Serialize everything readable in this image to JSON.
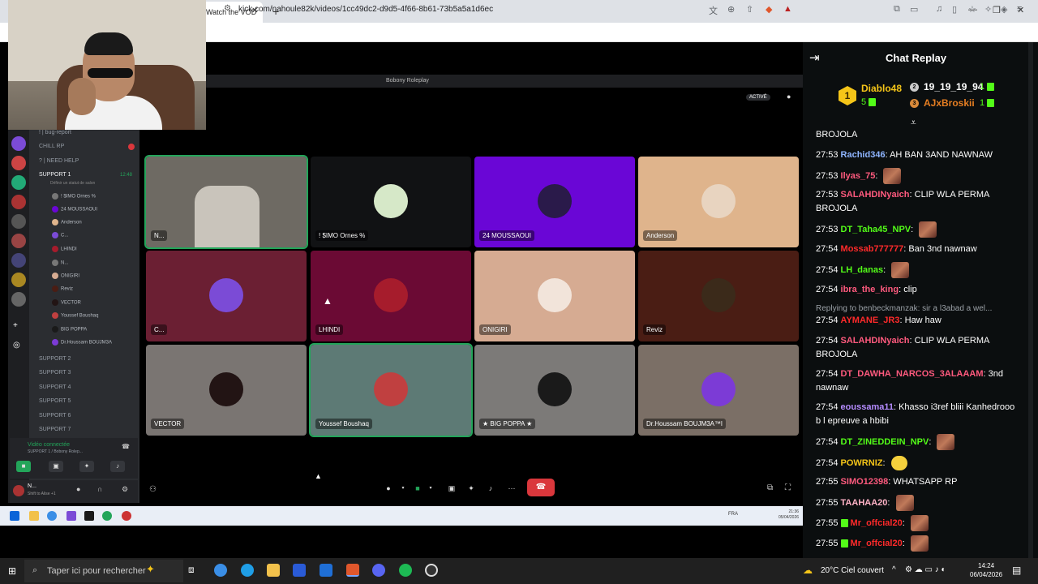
{
  "browser": {
    "tab_title": "Watch the VOD",
    "url": "kick.com/nahoule82k/videos/1cc49dc2-d9d5-4f66-8b61-73b5a5a1d6ec"
  },
  "discord": {
    "window_title": "Bobony Roleplay",
    "active_label": "ACTIVÉ",
    "channels": [
      {
        "label": "! | bug-report",
        "active": false
      },
      {
        "label": "CHILL RP",
        "active": false
      },
      {
        "label": "? | NEED HELP",
        "active": false
      },
      {
        "label": "SUPPORT 1",
        "active": true
      },
      {
        "label": "SUPPORT 2",
        "active": false
      },
      {
        "label": "SUPPORT 3",
        "active": false
      },
      {
        "label": "SUPPORT 4",
        "active": false
      },
      {
        "label": "SUPPORT 5",
        "active": false
      },
      {
        "label": "SUPPORT 6",
        "active": false
      },
      {
        "label": "SUPPORT 7",
        "active": false
      }
    ],
    "support1_time": "12:48",
    "support1_status": "Définir un statut de salon",
    "voice_members": [
      "! $IMO Ornes %",
      "24 MOUSSAOUI",
      "Anderson",
      "C...",
      "LHINDI",
      "N...",
      "ONIGIRI",
      "Reviz",
      "VECTOR",
      "Youssef Boushaq",
      "BIG POPPA",
      "Dr.Houssam BOUJM3A"
    ],
    "voice_status": "Vidéo connectée",
    "voice_sub": "SUPPORT 1 / Bobony Rolep...",
    "user_name": "N...",
    "user_sub": "Shift to Alise +1",
    "tiles": [
      {
        "name": "N...",
        "bg": "#6e6a63",
        "av": "#c9c4bb",
        "speaking": true
      },
      {
        "name": "! $IMO Ornes %",
        "bg": "#111214",
        "av": "#d6e8c8",
        "speaking": false
      },
      {
        "name": "24 MOUSSAOUI",
        "bg": "#6a06d6",
        "av": "#2a1a4a",
        "speaking": false
      },
      {
        "name": "Anderson",
        "bg": "#dfb48c",
        "av": "#e8d4c0",
        "speaking": false
      },
      {
        "name": "C...",
        "bg": "#6b1f33",
        "av": "#7b4bd6",
        "speaking": false
      },
      {
        "name": "LHINDI",
        "bg": "#6b0a34",
        "av": "#a61c2c",
        "speaking": false
      },
      {
        "name": "ONIGIRI",
        "bg": "#d6ab92",
        "av": "#f2e4da",
        "speaking": false
      },
      {
        "name": "Reviz",
        "bg": "#4a1d14",
        "av": "#3b2a1a",
        "speaking": false
      },
      {
        "name": "VECTOR",
        "bg": "#7a7572",
        "av": "#221414",
        "speaking": false
      },
      {
        "name": "Youssef Boushaq",
        "bg": "#5d7a75",
        "av": "#c04040",
        "speaking": true
      },
      {
        "name": "★ BIG POPPA ★",
        "bg": "#7c7a78",
        "av": "#1a1a1a",
        "speaking": false
      },
      {
        "name": "Dr.Houssam BOUJM3A™l",
        "bg": "#7b6f66",
        "av": "#7c3bd6",
        "speaking": false
      }
    ],
    "inner_clock": {
      "time": "21:36",
      "date": "05/04/2026"
    },
    "inner_tray": "FRA"
  },
  "chat": {
    "title": "Chat Replay",
    "leaderboard": {
      "first": {
        "rank": "1",
        "name": "Diablo48",
        "count": "5"
      },
      "second": {
        "name": "19_19_19_94",
        "count": "1"
      },
      "third": {
        "name": "AJxBroskii",
        "count": "1"
      }
    },
    "messages": [
      {
        "time": "",
        "user": "",
        "color": "#fff",
        "text": "BROJOLA",
        "emote": ""
      },
      {
        "time": "27:53",
        "user": "Rachid346",
        "color": "#8fb5ff",
        "text": "AH BAN 3AND NAWNAW",
        "emote": ""
      },
      {
        "time": "27:53",
        "user": "Ilyas_75",
        "color": "#ff5a7e",
        "text": "",
        "emote": "emote"
      },
      {
        "time": "27:53",
        "user": "SALAHDINyaich",
        "color": "#ff5a7e",
        "text": "CLIP WLA PERMA BROJOLA",
        "emote": ""
      },
      {
        "time": "27:53",
        "user": "DT_Taha45_NPV",
        "color": "#53fc18",
        "text": "",
        "emote": "emote"
      },
      {
        "time": "27:54",
        "user": "Mossab777777",
        "color": "#ff2a2a",
        "text": "Ban 3nd nawnaw",
        "emote": ""
      },
      {
        "time": "27:54",
        "user": "LH_danas",
        "color": "#53fc18",
        "text": "",
        "emote": "emote"
      },
      {
        "time": "27:54",
        "user": "ibra_the_king",
        "color": "#ff5a7e",
        "text": "clip",
        "emote": ""
      },
      {
        "time": "",
        "user": "",
        "color": "#9aa0a6",
        "text": "Replying to benbeckmanzak: sir a l3abad a wel...",
        "emote": "reply"
      },
      {
        "time": "27:54",
        "user": "AYMANE_JR3",
        "color": "#ff2a2a",
        "text": "Haw haw",
        "emote": ""
      },
      {
        "time": "27:54",
        "user": "SALAHDINyaich",
        "color": "#ff5a7e",
        "text": "CLIP WLA PERMA BROJOLA",
        "emote": ""
      },
      {
        "time": "27:54",
        "user": "DT_DAWHA_NARCOS_3ALAAAM",
        "color": "#ff5a7e",
        "text": "3nd nawnaw",
        "emote": ""
      },
      {
        "time": "27:54",
        "user": "eoussama11",
        "color": "#b58cff",
        "text": "Khasso i3ref bliii Kanhedrooo b l epreuve a hbibi",
        "emote": ""
      },
      {
        "time": "27:54",
        "user": "DT_ZINEDDEIN_NPV",
        "color": "#53fc18",
        "text": "",
        "emote": "emote"
      },
      {
        "time": "27:54",
        "user": "POWRNIZ",
        "color": "#f5c518",
        "text": "",
        "emote": "yellow"
      },
      {
        "time": "27:55",
        "user": "SIMO12398",
        "color": "#ff5a7e",
        "text": "WHATSAPP RP",
        "emote": ""
      },
      {
        "time": "27:55",
        "user": "TAAHAA20",
        "color": "#ffb3c7",
        "text": "",
        "emote": "emote"
      },
      {
        "time": "27:55",
        "user": "Mr_offcial20",
        "color": "#ff2a2a",
        "text": "",
        "emote": "gift"
      },
      {
        "time": "27:55",
        "user": "Mr_offcial20",
        "color": "#ff2a2a",
        "text": "",
        "emote": "gift"
      }
    ]
  },
  "taskbar": {
    "search_placeholder": "Taper ici pour rechercher",
    "weather": "20°C Ciel couvert",
    "time": "14:24",
    "date": "06/04/2026"
  }
}
